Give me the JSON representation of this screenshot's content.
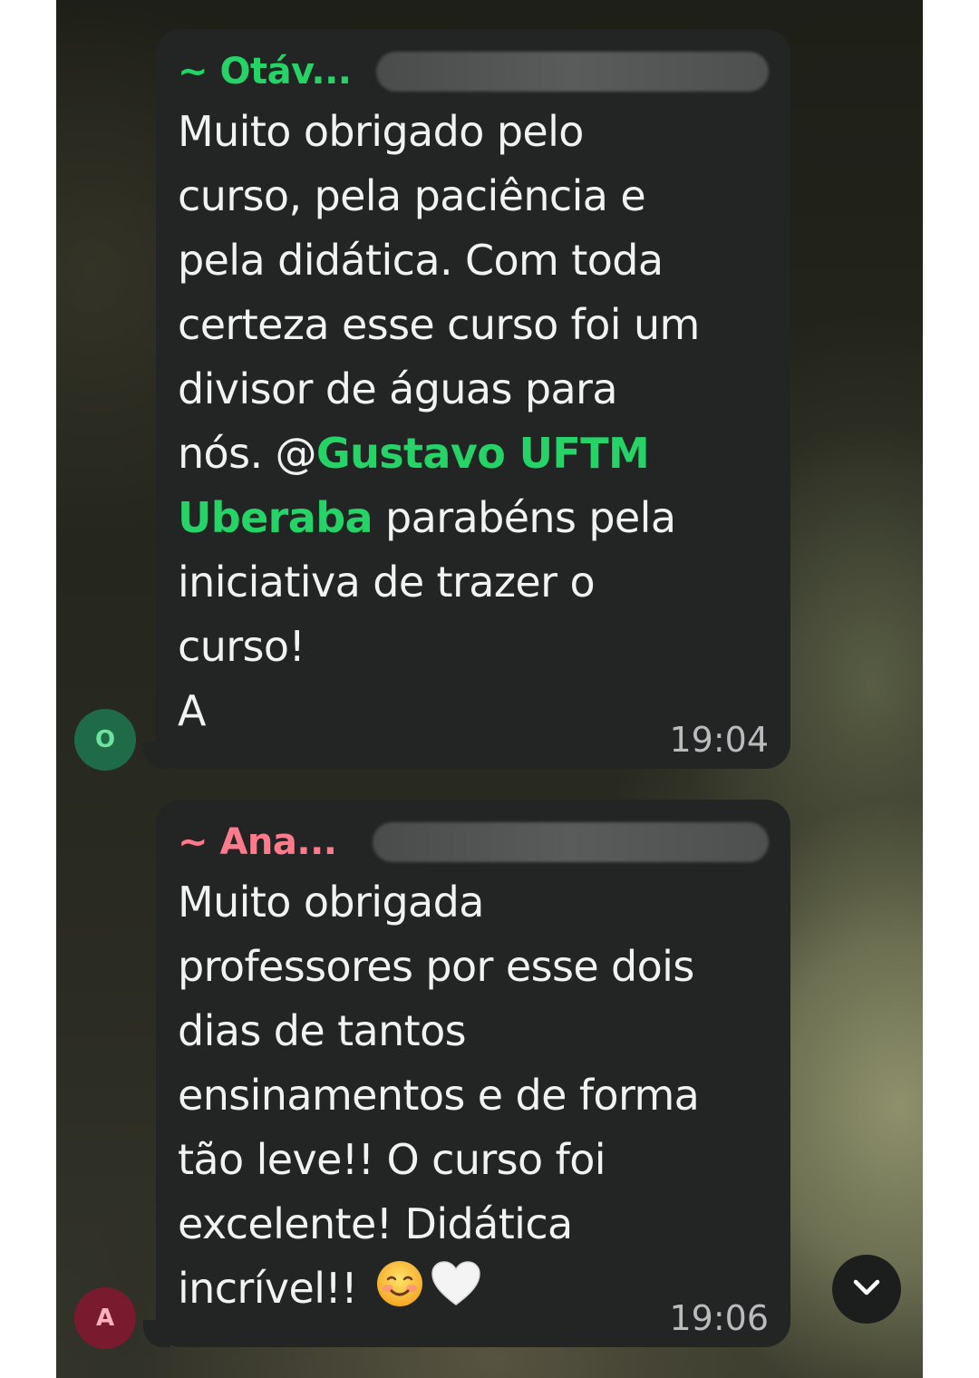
{
  "messages": [
    {
      "sender": "~ Otáv...",
      "avatar_letter": "O",
      "text_before": "Muito obrigado pelo\ncurso, pela paciência e\npela didática. Com toda\ncerteza esse curso foi um\ndivisor de águas para\nnós.  @",
      "mention": "Gustavo UFTM\nUberaba",
      "text_after": " parabéns pela\niniciativa de trazer o\ncurso!\nA",
      "time": "19:04"
    },
    {
      "sender": "~ Ana...",
      "avatar_letter": "A",
      "text": "Muito obrigada\nprofessores por esse dois\ndias de tantos\nensinamentos e de forma\ntão leve!! O curso foi\nexcelente! Didática\nincrível!! ",
      "emoji_1": "smiling-face-icon",
      "emoji_2": "white-heart-icon",
      "time": "19:06"
    }
  ],
  "colors": {
    "bubble": "#232525",
    "sender_1": "#25d366",
    "sender_2": "#ff7a8a",
    "mention": "#25d366"
  },
  "scroll_button": {
    "icon": "chevron-down-icon"
  }
}
